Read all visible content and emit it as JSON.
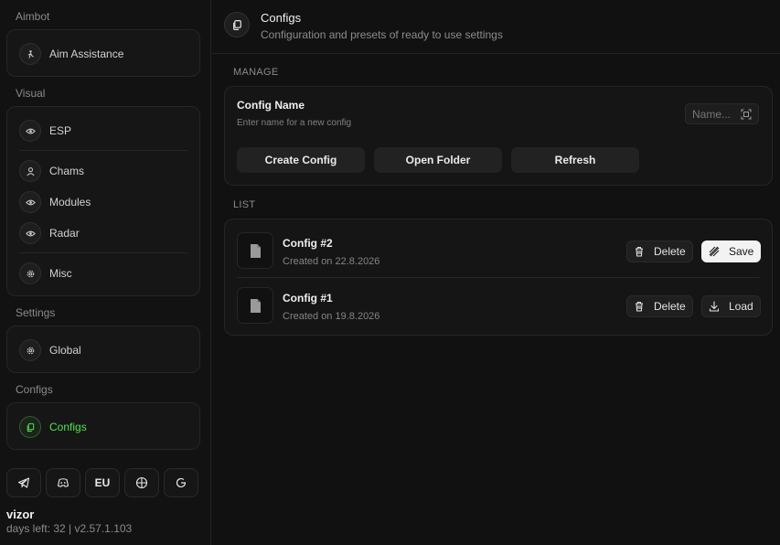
{
  "sidebar": {
    "sections": {
      "aimbot": "Aimbot",
      "visual": "Visual",
      "settings": "Settings",
      "configs": "Configs"
    },
    "items": {
      "aim_assistance": "Aim Assistance",
      "esp": "ESP",
      "chams": "Chams",
      "modules": "Modules",
      "radar": "Radar",
      "misc": "Misc",
      "global": "Global",
      "configs": "Configs"
    },
    "active_item": "Configs",
    "bottom_buttons": {
      "telegram": "telegram-icon",
      "discord": "discord-icon",
      "region": "EU",
      "globe": "globe-icon",
      "refresh": "refresh-icon"
    },
    "user": {
      "name": "vizor",
      "meta": "days left: 32 | v2.57.1.103"
    }
  },
  "header": {
    "title": "Configs",
    "subtitle": "Configuration and presets of ready to use settings"
  },
  "manage": {
    "label": "MANAGE",
    "config_name_title": "Config Name",
    "config_name_sub": "Enter name for a new config",
    "name_placeholder": "Name...",
    "name_value": "",
    "buttons": {
      "create": "Create Config",
      "open": "Open Folder",
      "refresh": "Refresh"
    }
  },
  "list": {
    "label": "LIST",
    "items": [
      {
        "name": "Config #2",
        "date": "Created on 22.8.2026",
        "delete": "Delete",
        "action": "Save"
      },
      {
        "name": "Config #1",
        "date": "Created on 19.8.2026",
        "delete": "Delete",
        "action": "Load"
      }
    ]
  },
  "colors": {
    "accent": "#4ee54e",
    "background": "#111111",
    "card": "#161616"
  }
}
